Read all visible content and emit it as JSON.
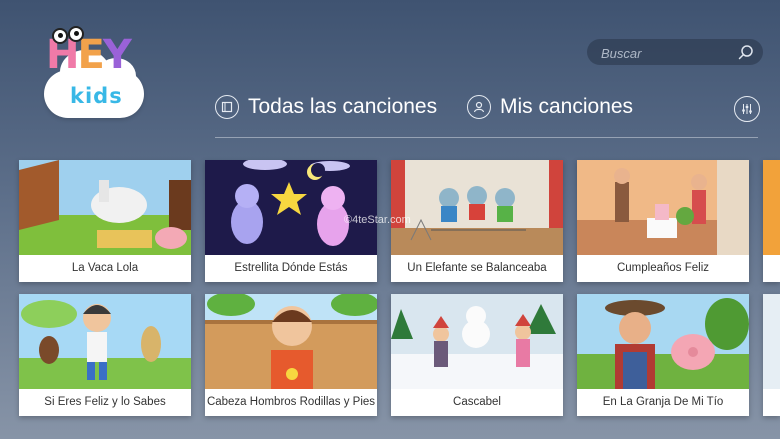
{
  "logo": {
    "hey_letters": [
      "H",
      "E",
      "Y"
    ],
    "kids": "kids"
  },
  "search": {
    "placeholder": "Buscar",
    "icon": "search-icon"
  },
  "nav": {
    "all_songs": "Todas las canciones",
    "my_songs": "Mis canciones",
    "filter_icon": "sliders-icon"
  },
  "songs": [
    "La Vaca Lola",
    "Estrellita Dónde Estás",
    "Un Elefante se Balanceaba",
    "Cumpleaños Feliz",
    "Si Eres Feliz y lo Sabes",
    "Cabeza Hombros Rodillas y Pies",
    "Cascabel",
    "En La Granja De Mi Tío"
  ],
  "watermark": "©4teStar.com",
  "colors": {
    "background_top": "#3f5371",
    "background_bottom": "#8794a7",
    "accent_kids": "#38b8e6"
  }
}
